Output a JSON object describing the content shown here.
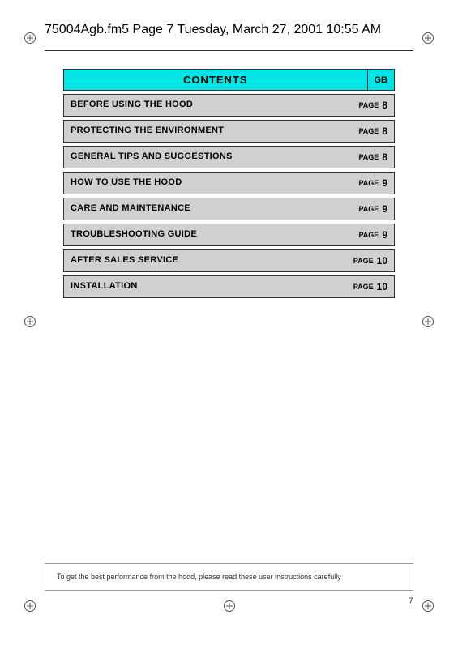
{
  "header": {
    "file_info": "75004Agb.fm5  Page 7  Tuesday, March 27, 2001  10:55 AM"
  },
  "contents": {
    "title": "CONTENTS",
    "gb_label": "GB",
    "rows": [
      {
        "label": "BEFORE USING THE HOOD",
        "page_word": "PAGE",
        "page_num": "8"
      },
      {
        "label": "PROTECTING THE ENVIRONMENT",
        "page_word": "PAGE",
        "page_num": "8"
      },
      {
        "label": "GENERAL TIPS AND SUGGESTIONS",
        "page_word": "PAGE",
        "page_num": "8"
      },
      {
        "label": "HOW TO USE THE HOOD",
        "page_word": "PAGE",
        "page_num": "9"
      },
      {
        "label": "CARE AND MAINTENANCE",
        "page_word": "PAGE",
        "page_num": "9"
      },
      {
        "label": "TROUBLESHOOTING GUIDE",
        "page_word": "PAGE",
        "page_num": "9"
      },
      {
        "label": "AFTER SALES SERVICE",
        "page_word": "PAGE",
        "page_num": "10"
      },
      {
        "label": "INSTALLATION",
        "page_word": "PAGE",
        "page_num": "10"
      }
    ]
  },
  "bottom_note": {
    "text": "To get the best performance from the hood, please read these user instructions carefully"
  },
  "page_number": "7"
}
